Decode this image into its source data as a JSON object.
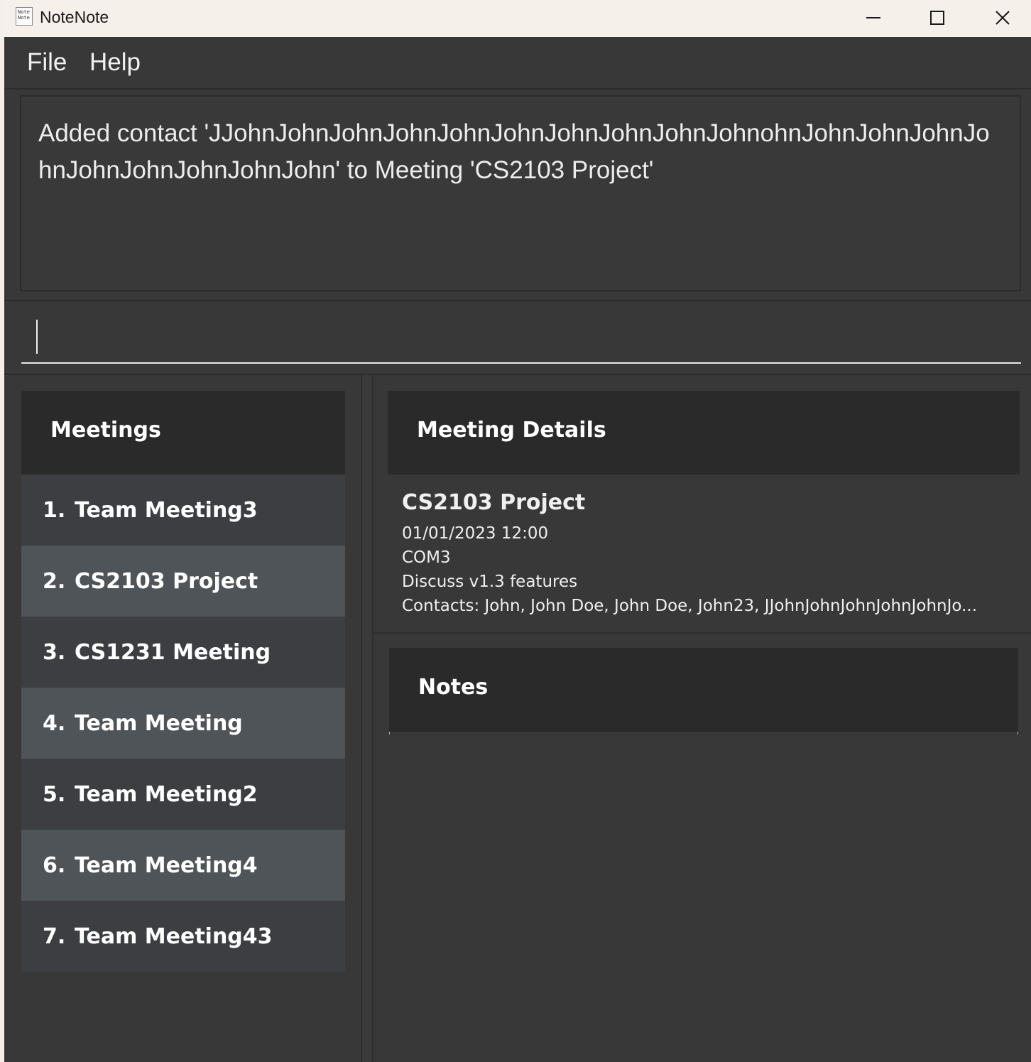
{
  "window": {
    "title": "NoteNote",
    "icon_name": "notenote-app-icon",
    "icon_text": "Note Note"
  },
  "menu": {
    "items": [
      {
        "label": "File"
      },
      {
        "label": "Help"
      }
    ]
  },
  "result": {
    "text": "Added contact 'JJohnJohnJohnJohnJohnJohnJohnJohnJohnJohnohnJohnJohnJohnJohnJohnJohnJohnJohnJohn' to Meeting 'CS2103 Project'"
  },
  "command": {
    "value": "",
    "placeholder": ""
  },
  "meetings": {
    "header": "Meetings",
    "items": [
      {
        "index": "1.",
        "name": "Team Meeting3"
      },
      {
        "index": "2.",
        "name": "CS2103 Project"
      },
      {
        "index": "3.",
        "name": "CS1231 Meeting"
      },
      {
        "index": "4.",
        "name": "Team Meeting"
      },
      {
        "index": "5.",
        "name": "Team Meeting2"
      },
      {
        "index": "6.",
        "name": "Team Meeting4"
      },
      {
        "index": "7.",
        "name": "Team Meeting43"
      }
    ]
  },
  "details": {
    "header": "Meeting Details",
    "title": "CS2103 Project",
    "datetime": "01/01/2023 12:00",
    "location": "COM3",
    "agenda": "Discuss v1.3 features",
    "contacts": "Contacts: John, John Doe, John  Doe, John23, JJohnJohnJohnJohnJohnJo..."
  },
  "notes": {
    "header": "Notes"
  },
  "colors": {
    "titlebar_bg": "#f6f0ea",
    "app_bg": "#383838",
    "header_bg": "#2a2a2a",
    "row_odd": "#3c3e41",
    "row_even": "#4f5458"
  }
}
